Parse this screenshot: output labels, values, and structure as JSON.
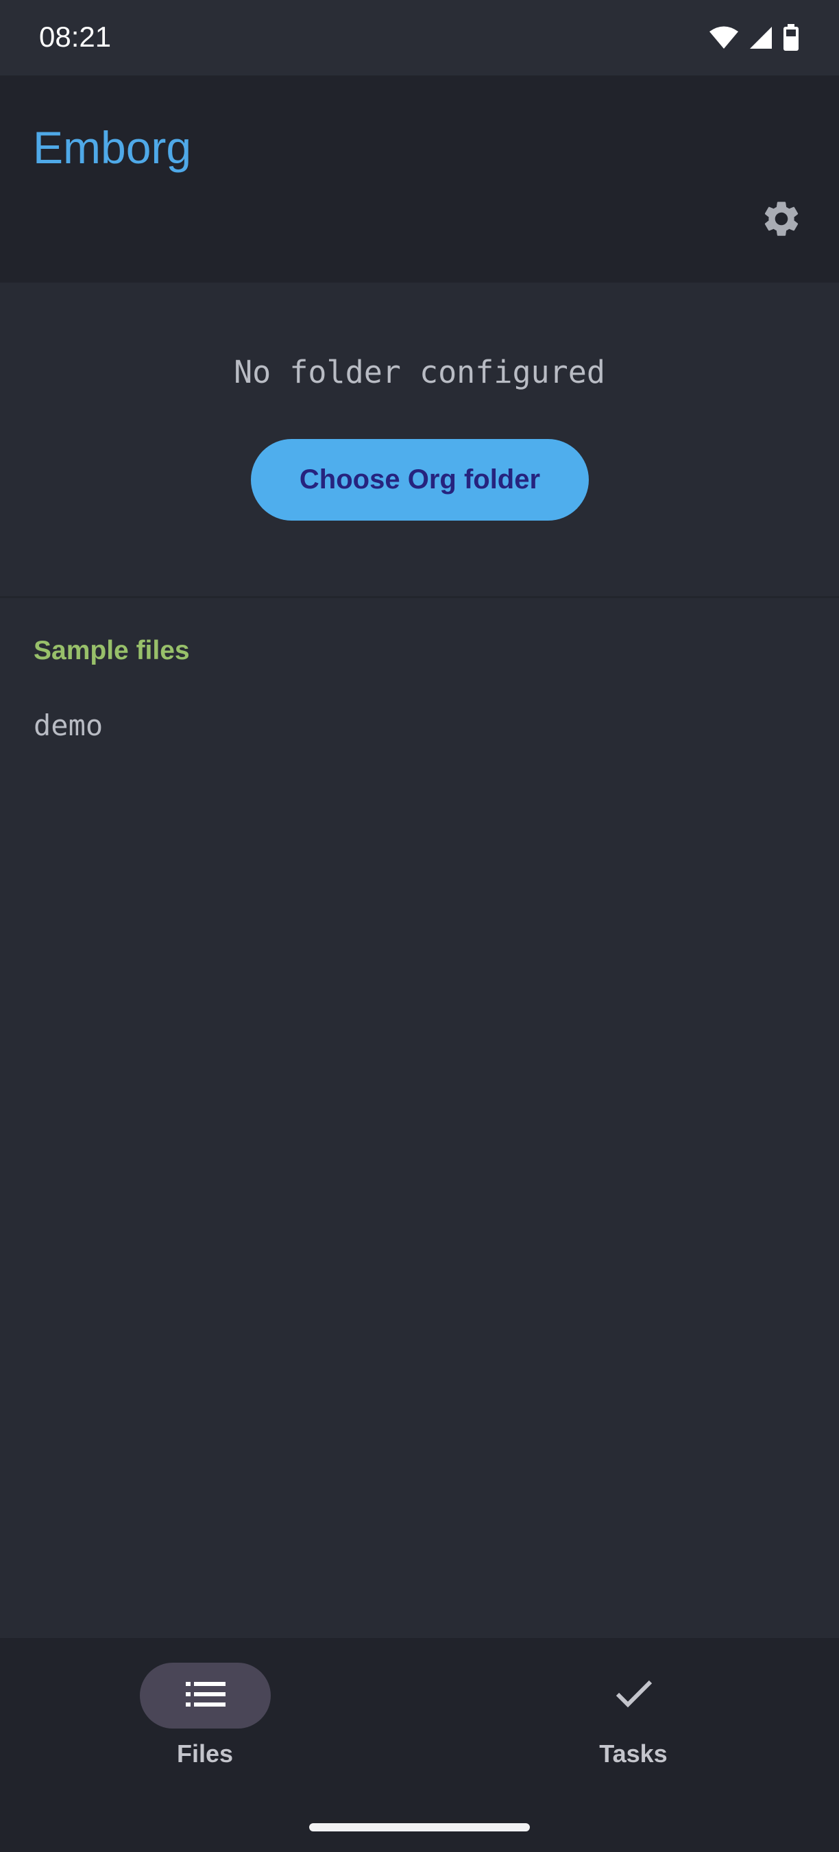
{
  "status_bar": {
    "time": "08:21",
    "icons": [
      "wifi-icon",
      "cell-signal-icon",
      "battery-icon"
    ]
  },
  "app_bar": {
    "title": "Emborg",
    "settings_icon": "gear-icon"
  },
  "folder_section": {
    "message": "No folder configured",
    "choose_button_label": "Choose Org folder"
  },
  "sample_files": {
    "header": "Sample files",
    "items": [
      {
        "label": "demo"
      }
    ]
  },
  "bottom_nav": {
    "items": [
      {
        "label": "Files",
        "icon": "list-icon",
        "selected": true
      },
      {
        "label": "Tasks",
        "icon": "check-icon",
        "selected": false
      }
    ]
  },
  "colors": {
    "background": "#282b34",
    "app_bar": "#21232b",
    "title_accent": "#4fa9e8",
    "button_fill": "#4faeed",
    "button_text": "#26237e",
    "section_header": "#98c06a",
    "nav_pill": "#4a4657"
  }
}
